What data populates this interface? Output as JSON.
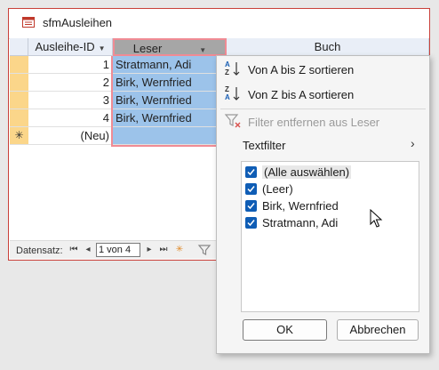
{
  "form": {
    "title": "sfmAusleihen",
    "columns": {
      "id": "Ausleihe-ID",
      "leser": "Leser",
      "buch": "Buch"
    },
    "rows": [
      {
        "id": "1",
        "leser": "Stratmann, Adi"
      },
      {
        "id": "2",
        "leser": "Birk, Wernfried"
      },
      {
        "id": "3",
        "leser": "Birk, Wernfried"
      },
      {
        "id": "4",
        "leser": "Birk, Wernfried"
      }
    ],
    "new_row": {
      "marker": "✳",
      "id": "(Neu)"
    }
  },
  "nav": {
    "label": "Datensatz:",
    "position": "1 von 4"
  },
  "menu": {
    "sort_az": "Von A bis Z sortieren",
    "sort_za": "Von Z bis A sortieren",
    "remove_filter": "Filter entfernen aus Leser",
    "text_filter": "Textfilter",
    "options": [
      {
        "label": "(Alle auswählen)",
        "checked": true
      },
      {
        "label": "(Leer)",
        "checked": true
      },
      {
        "label": "Birk, Wernfried",
        "checked": true
      },
      {
        "label": "Stratmann, Adi",
        "checked": true
      }
    ],
    "ok": "OK",
    "cancel": "Abbrechen"
  },
  "colors": {
    "selected_header": "#a6a6a6",
    "selected_column": "#9cc3ea",
    "row_selector": "#fbd68a",
    "checkbox": "#0f5db5",
    "focus_border": "#f08b94"
  }
}
